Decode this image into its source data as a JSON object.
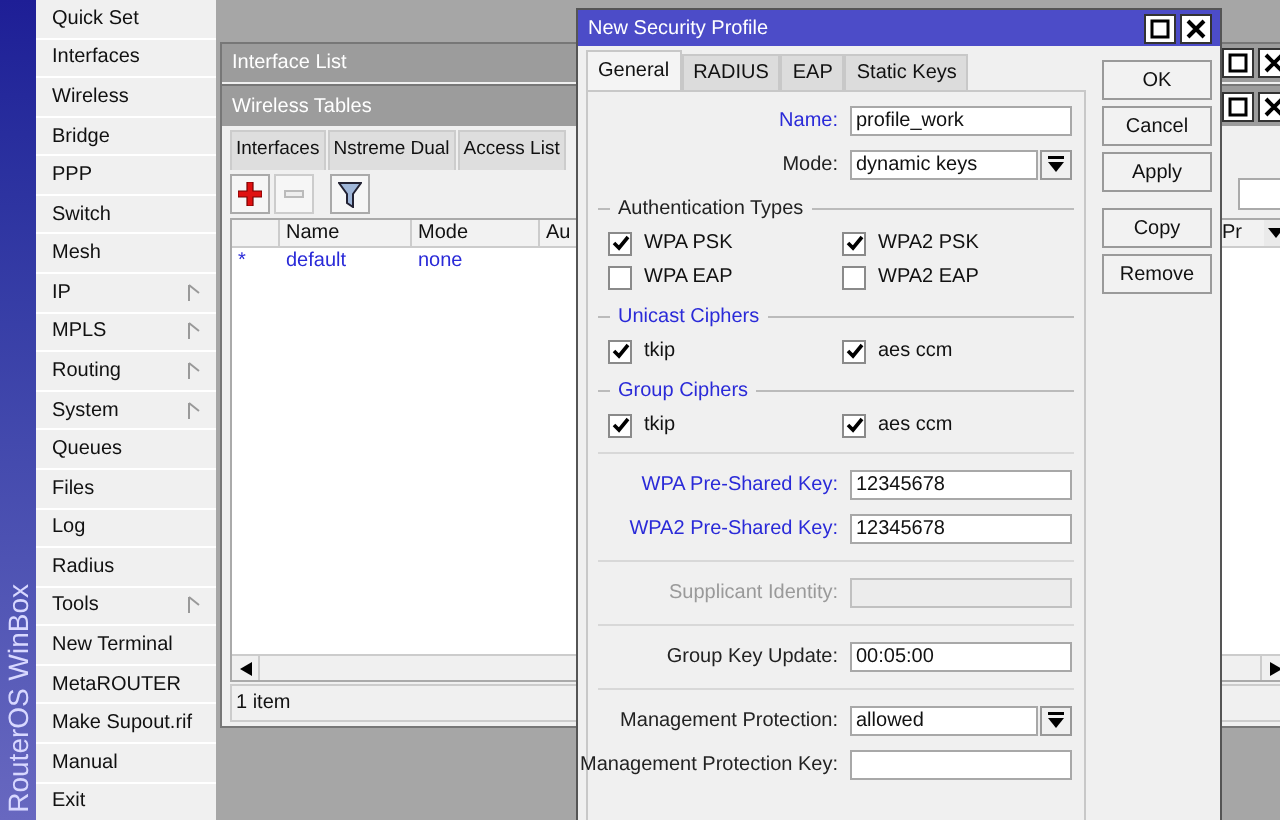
{
  "sidebar": {
    "brand": "RouterOS WinBox",
    "items": [
      {
        "label": "Quick Set",
        "submenu": false
      },
      {
        "label": "Interfaces",
        "submenu": false
      },
      {
        "label": "Wireless",
        "submenu": false
      },
      {
        "label": "Bridge",
        "submenu": false
      },
      {
        "label": "PPP",
        "submenu": false
      },
      {
        "label": "Switch",
        "submenu": false
      },
      {
        "label": "Mesh",
        "submenu": false
      },
      {
        "label": "IP",
        "submenu": true
      },
      {
        "label": "MPLS",
        "submenu": true
      },
      {
        "label": "Routing",
        "submenu": true
      },
      {
        "label": "System",
        "submenu": true
      },
      {
        "label": "Queues",
        "submenu": false
      },
      {
        "label": "Files",
        "submenu": false
      },
      {
        "label": "Log",
        "submenu": false
      },
      {
        "label": "Radius",
        "submenu": false
      },
      {
        "label": "Tools",
        "submenu": true
      },
      {
        "label": "New Terminal",
        "submenu": false
      },
      {
        "label": "MetaROUTER",
        "submenu": false
      },
      {
        "label": "Make Supout.rif",
        "submenu": false
      },
      {
        "label": "Manual",
        "submenu": false
      },
      {
        "label": "Exit",
        "submenu": false
      }
    ]
  },
  "interface_list": {
    "title": "Interface List"
  },
  "wireless_tables": {
    "title": "Wireless Tables",
    "tabs": [
      {
        "label": "Interfaces",
        "selected": false
      },
      {
        "label": "Nstreme Dual",
        "selected": false
      },
      {
        "label": "Access List",
        "selected": false
      }
    ],
    "columns": [
      "Name",
      "Mode",
      "Au"
    ],
    "last_column": "Pr",
    "rows": [
      {
        "marker": "*",
        "cells": [
          "default",
          "none"
        ]
      }
    ],
    "status": "1 item"
  },
  "dialog": {
    "title": "New Security Profile",
    "tabs": [
      {
        "label": "General",
        "selected": true
      },
      {
        "label": "RADIUS",
        "selected": false
      },
      {
        "label": "EAP",
        "selected": false
      },
      {
        "label": "Static Keys",
        "selected": false
      }
    ],
    "form": [
      {
        "kind": "field",
        "label": "Name:",
        "value": "profile_work",
        "highlighted": true,
        "disabled": false
      },
      {
        "kind": "select",
        "label": "Mode:",
        "value": "dynamic keys",
        "highlighted": false,
        "disabled": false
      },
      {
        "kind": "group",
        "title": "Authentication Types",
        "highlighted": false,
        "options": [
          {
            "label": "WPA PSK",
            "checked": true
          },
          {
            "label": "WPA2 PSK",
            "checked": true
          },
          {
            "label": "WPA EAP",
            "checked": false
          },
          {
            "label": "WPA2 EAP",
            "checked": false
          }
        ]
      },
      {
        "kind": "group",
        "title": "Unicast Ciphers",
        "highlighted": true,
        "options": [
          {
            "label": "tkip",
            "checked": true
          },
          {
            "label": "aes ccm",
            "checked": true
          }
        ]
      },
      {
        "kind": "group",
        "title": "Group Ciphers",
        "highlighted": true,
        "options": [
          {
            "label": "tkip",
            "checked": true
          },
          {
            "label": "aes ccm",
            "checked": true
          }
        ]
      },
      {
        "kind": "separator"
      },
      {
        "kind": "field",
        "label": "WPA Pre-Shared Key:",
        "value": "12345678",
        "highlighted": true,
        "disabled": false
      },
      {
        "kind": "field",
        "label": "WPA2 Pre-Shared Key:",
        "value": "12345678",
        "highlighted": true,
        "disabled": false
      },
      {
        "kind": "separator"
      },
      {
        "kind": "field",
        "label": "Supplicant Identity:",
        "disabled": true
      },
      {
        "kind": "separator"
      },
      {
        "kind": "field",
        "label": "Group Key Update:",
        "value": "00:05:00",
        "highlighted": false,
        "disabled": false
      },
      {
        "kind": "separator"
      },
      {
        "kind": "select",
        "label": "Management Protection:",
        "value": "allowed",
        "highlighted": false,
        "disabled": false
      },
      {
        "kind": "field",
        "label": "Management Protection Key:",
        "highlighted": false,
        "disabled": false
      }
    ],
    "buttons": [
      [
        "OK",
        "Cancel",
        "Apply"
      ],
      [
        "Copy",
        "Remove"
      ]
    ]
  }
}
